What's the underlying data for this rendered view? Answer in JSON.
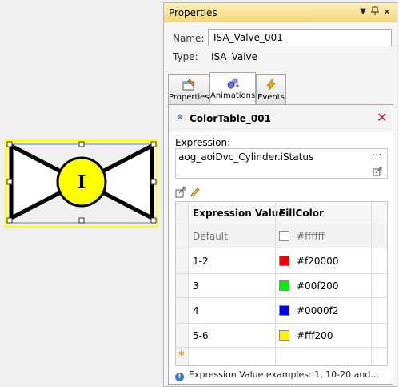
{
  "panel": {
    "title": "Properties",
    "name_label": "Name:",
    "name_value": "ISA_Valve_001",
    "type_label": "Type:",
    "type_value": "ISA_Valve"
  },
  "tabs": [
    {
      "label": "Properties",
      "icon": "properties-icon"
    },
    {
      "label": "Animations",
      "icon": "animations-icon",
      "active": true
    },
    {
      "label": "Events",
      "icon": "events-icon"
    }
  ],
  "animation": {
    "title": "ColorTable_001",
    "expression_label": "Expression:",
    "expression_value": "aog_aoiDvc_Cylinder.iStatus",
    "more_label": "...",
    "columns": [
      "Expression Value",
      "FillColor"
    ],
    "rows": [
      {
        "expr": "Default",
        "color": "#ffffff",
        "label": "#ffffff",
        "muted": true
      },
      {
        "expr": "1-2",
        "color": "#f20000",
        "label": "#f20000"
      },
      {
        "expr": "3",
        "color": "#00f200",
        "label": "#00f200"
      },
      {
        "expr": "4",
        "color": "#0000f2",
        "label": "#0000f2"
      },
      {
        "expr": "5-6",
        "color": "#fff200",
        "label": "#fff200"
      }
    ],
    "new_row_marker": "*",
    "hint": "Expression Value examples: 1, 10-20 and..."
  },
  "valve": {
    "label": "I",
    "fill": "#ffffff",
    "circle_fill": "#ffff00",
    "selection_color": "#ffff00"
  }
}
